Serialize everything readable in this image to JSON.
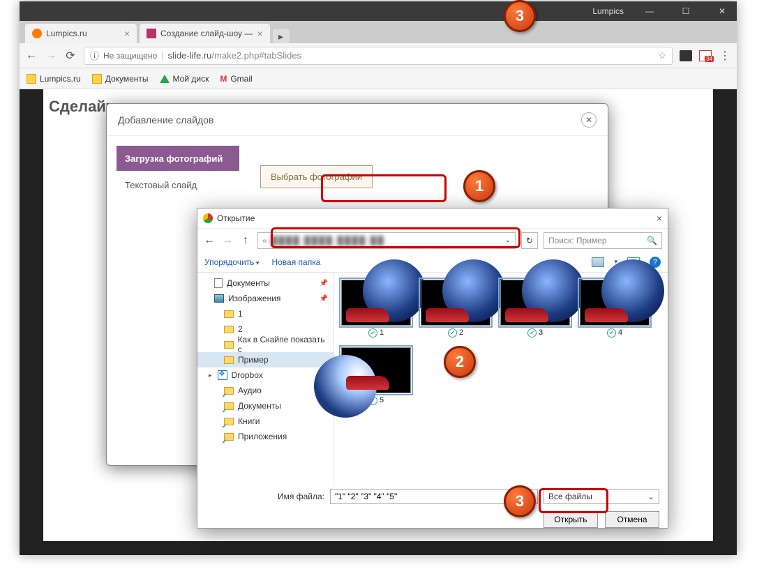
{
  "window": {
    "title": "Lumpics"
  },
  "tabs": [
    {
      "label": "Lumpics.ru"
    },
    {
      "label": "Создание слайд-шоу —"
    }
  ],
  "address": {
    "insecure": "Не защищено",
    "host": "slide-life.ru",
    "path": "/make2.php#tabSlides"
  },
  "ext_badge": "34",
  "bookmarks": [
    "Lumpics.ru",
    "Документы",
    "Мой диск",
    "Gmail"
  ],
  "page": {
    "heading": "Сделайте"
  },
  "modal": {
    "title": "Добавление слайдов",
    "tab_upload": "Загрузка фотографий",
    "tab_text": "Текстовый слайд",
    "choose_btn": "Выбрать фотографии"
  },
  "dialog": {
    "title": "Открытие",
    "back": "←",
    "fwd": "→",
    "up": "↑",
    "crumb_prefix": "«",
    "refresh": "↻",
    "search_placeholder": "Поиск: Пример",
    "organize": "Упорядочить",
    "new_folder": "Новая папка",
    "tree": {
      "documents": "Документы",
      "images": "Изображения",
      "f1": "1",
      "f2": "2",
      "skype": "Как в Скайпе показать с",
      "example": "Пример",
      "dropbox": "Dropbox",
      "audio": "Аудио",
      "docs2": "Документы",
      "books": "Книги",
      "apps": "Приложения"
    },
    "files": [
      "1",
      "2",
      "3",
      "4",
      "5"
    ],
    "filename_label": "Имя файла:",
    "filename_value": "\"1\" \"2\" \"3\" \"4\" \"5\"",
    "filter": "Все файлы",
    "open": "Открыть",
    "cancel": "Отмена"
  },
  "badges": {
    "b1": "1",
    "b2": "2",
    "b3": "3"
  }
}
